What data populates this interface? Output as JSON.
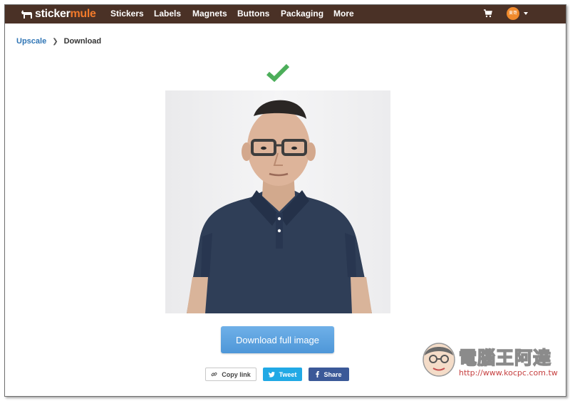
{
  "brand": {
    "name_part1": "sticker",
    "name_part2": "mule"
  },
  "nav": {
    "items": [
      "Stickers",
      "Labels",
      "Magnets",
      "Buttons",
      "Packaging",
      "More"
    ],
    "avatar_text": "東哥"
  },
  "breadcrumb": {
    "parent": "Upscale",
    "current": "Download"
  },
  "actions": {
    "download_label": "Download full image",
    "copy_label": "Copy link",
    "tweet_label": "Tweet",
    "share_label": "Share"
  },
  "watermark": {
    "title": "電腦王阿達",
    "url": "http://www.kocpc.com.tw"
  },
  "colors": {
    "navbar": "#4a3126",
    "brand_accent": "#f27a2b",
    "check": "#4cae5a",
    "download_button": "#5ba3e0",
    "tweet": "#21a9e5",
    "share": "#3b5998"
  },
  "icons": {
    "logo": "mule-icon",
    "cart": "cart-icon",
    "check": "checkmark-icon",
    "link": "link-icon",
    "twitter": "twitter-icon",
    "facebook": "facebook-icon"
  }
}
